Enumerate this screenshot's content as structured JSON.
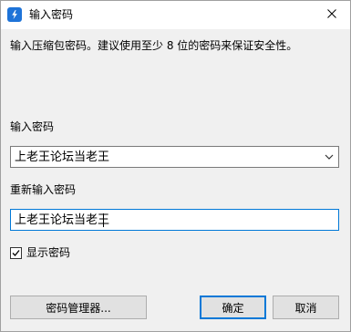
{
  "window": {
    "title": "输入密码",
    "icon": "app-logo-icon"
  },
  "dialog": {
    "info_text": "输入压缩包密码。建议使用至少 8 位的密码来保证安全性。",
    "password_label": "输入密码",
    "password_value": "上老王论坛当老王",
    "reenter_label": "重新输入密码",
    "reenter_value": "上老王论坛当老王",
    "show_password_label": "显示密码",
    "show_password_checked": true
  },
  "buttons": {
    "manager_label": "密码管理器...",
    "ok_label": "确定",
    "cancel_label": "取消"
  },
  "colors": {
    "accent": "#0078d7",
    "client_bg": "#f0f0f0",
    "button_bg": "#e1e1e1"
  }
}
